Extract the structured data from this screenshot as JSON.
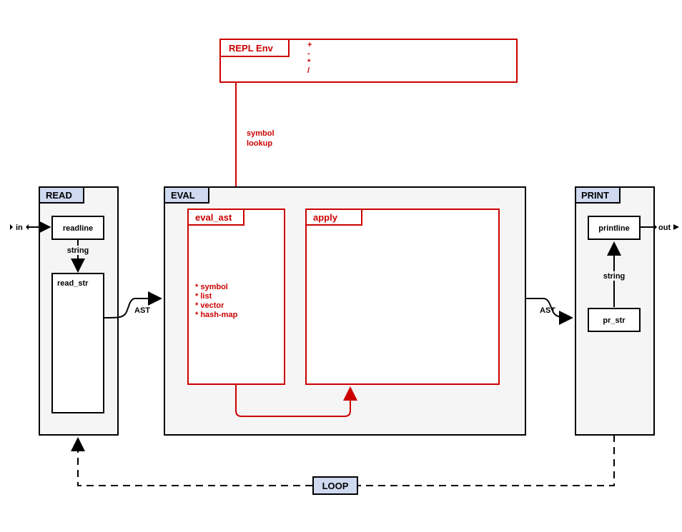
{
  "replEnv": {
    "title": "REPL Env",
    "ops": [
      "+",
      "-",
      "*",
      "/"
    ]
  },
  "arrows": {
    "symbolLookup1": "symbol",
    "symbolLookup2": "lookup",
    "in": "in",
    "out": "out",
    "string1": "string",
    "string2": "string",
    "ast1": "AST",
    "ast2": "AST"
  },
  "read": {
    "title": "READ",
    "readline": "readline",
    "read_str": "read_str"
  },
  "eval": {
    "title": "EVAL",
    "eval_ast": {
      "title": "eval_ast",
      "items": [
        "* symbol",
        "* list",
        "* vector",
        "* hash-map"
      ]
    },
    "apply": {
      "title": "apply"
    }
  },
  "print": {
    "title": "PRINT",
    "printline": "printline",
    "pr_str": "pr_str"
  },
  "loop": "LOOP"
}
